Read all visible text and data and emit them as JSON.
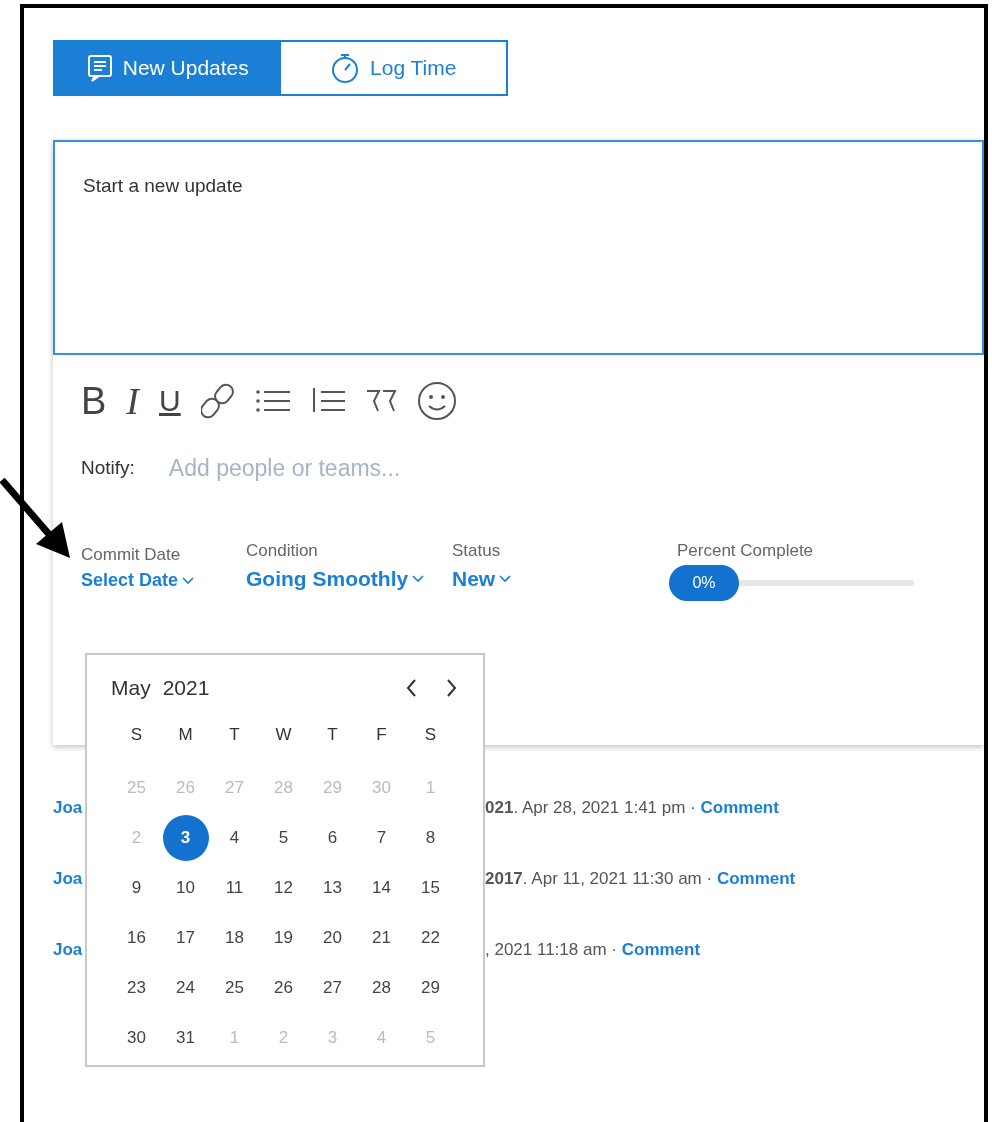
{
  "tabs": [
    {
      "label": "New Updates",
      "selected": true,
      "kind": "updates"
    },
    {
      "label": "Log Time",
      "selected": false,
      "kind": "timer"
    }
  ],
  "editor": {
    "placeholder": "Start a new update"
  },
  "toolbar": {
    "bold": "B",
    "italic": "I",
    "underline": "U"
  },
  "notify": {
    "label": "Notify:",
    "placeholder": "Add people or teams..."
  },
  "fields": [
    {
      "label": "Commit Date",
      "value": "Select Date",
      "kind": "date"
    },
    {
      "label": "Condition",
      "value": "Going Smoothly",
      "kind": "select"
    },
    {
      "label": "Status",
      "value": "New",
      "kind": "select"
    }
  ],
  "percent_complete": {
    "label": "Percent Complete",
    "reading": "0%",
    "level": 0
  },
  "feed": [
    {
      "author": "Joa",
      "text": "**021**. Apr 28, 2021 1:41 pm · ",
      "link": "Comment"
    },
    {
      "author": "Joa",
      "text": "**2017**. Apr 11, 2021 11:30 am · ",
      "link": "Comment"
    },
    {
      "author": "Joa",
      "text": ", 2021 11:18 am · ",
      "link": "Comment"
    }
  ],
  "calendar": {
    "month": "May",
    "year": "2021",
    "weekdays": [
      "S",
      "M",
      "T",
      "W",
      "T",
      "F",
      "S"
    ],
    "weeks": [
      [
        {
          "day": "25",
          "muted": true,
          "selected": false
        },
        {
          "day": "26",
          "muted": true,
          "selected": false
        },
        {
          "day": "27",
          "muted": true,
          "selected": false
        },
        {
          "day": "28",
          "muted": true,
          "selected": false
        },
        {
          "day": "29",
          "muted": true,
          "selected": false
        },
        {
          "day": "30",
          "muted": true,
          "selected": false
        },
        {
          "day": "1",
          "muted": true,
          "selected": false
        }
      ],
      [
        {
          "day": "2",
          "muted": true,
          "selected": false
        },
        {
          "day": "3",
          "muted": false,
          "selected": true
        },
        {
          "day": "4",
          "muted": false,
          "selected": false
        },
        {
          "day": "5",
          "muted": false,
          "selected": false
        },
        {
          "day": "6",
          "muted": false,
          "selected": false
        },
        {
          "day": "7",
          "muted": false,
          "selected": false
        },
        {
          "day": "8",
          "muted": false,
          "selected": false
        }
      ],
      [
        {
          "day": "9",
          "muted": false,
          "selected": false
        },
        {
          "day": "10",
          "muted": false,
          "selected": false
        },
        {
          "day": "11",
          "muted": false,
          "selected": false
        },
        {
          "day": "12",
          "muted": false,
          "selected": false
        },
        {
          "day": "13",
          "muted": false,
          "selected": false
        },
        {
          "day": "14",
          "muted": false,
          "selected": false
        },
        {
          "day": "15",
          "muted": false,
          "selected": false
        }
      ],
      [
        {
          "day": "16",
          "muted": false,
          "selected": false
        },
        {
          "day": "17",
          "muted": false,
          "selected": false
        },
        {
          "day": "18",
          "muted": false,
          "selected": false
        },
        {
          "day": "19",
          "muted": false,
          "selected": false
        },
        {
          "day": "20",
          "muted": false,
          "selected": false
        },
        {
          "day": "21",
          "muted": false,
          "selected": false
        },
        {
          "day": "22",
          "muted": false,
          "selected": false
        }
      ],
      [
        {
          "day": "23",
          "muted": false,
          "selected": false
        },
        {
          "day": "24",
          "muted": false,
          "selected": false
        },
        {
          "day": "25",
          "muted": false,
          "selected": false
        },
        {
          "day": "26",
          "muted": false,
          "selected": false
        },
        {
          "day": "27",
          "muted": false,
          "selected": false
        },
        {
          "day": "28",
          "muted": false,
          "selected": false
        },
        {
          "day": "29",
          "muted": false,
          "selected": false
        }
      ],
      [
        {
          "day": "30",
          "muted": false,
          "selected": false
        },
        {
          "day": "31",
          "muted": false,
          "selected": false
        },
        {
          "day": "1",
          "muted": true,
          "selected": false
        },
        {
          "day": "2",
          "muted": true,
          "selected": false
        },
        {
          "day": "3",
          "muted": true,
          "selected": false
        },
        {
          "day": "4",
          "muted": true,
          "selected": false
        },
        {
          "day": "5",
          "muted": true,
          "selected": false
        }
      ]
    ]
  }
}
